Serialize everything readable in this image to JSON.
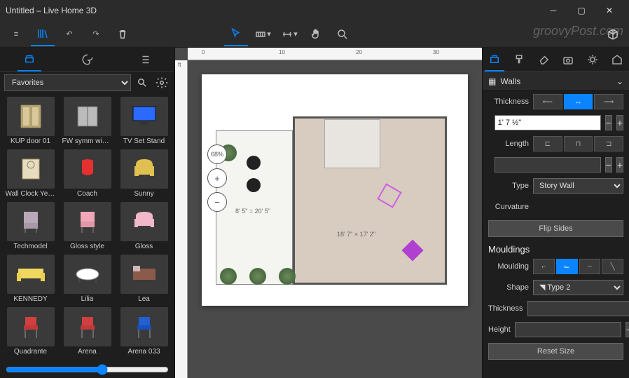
{
  "title": "Untitled – Live Home 3D",
  "watermark": "groovyPost.com",
  "favorites_label": "Favorites",
  "library": [
    {
      "label": "KUP door 01"
    },
    {
      "label": "FW symm windo…"
    },
    {
      "label": "TV Set Stand"
    },
    {
      "label": "Wall Clock Yello…"
    },
    {
      "label": "Coach"
    },
    {
      "label": "Sunny"
    },
    {
      "label": "Techmodel"
    },
    {
      "label": "Gloss style"
    },
    {
      "label": "Gloss"
    },
    {
      "label": "KENNEDY"
    },
    {
      "label": "Lilia"
    },
    {
      "label": "Lea"
    },
    {
      "label": "Quadrante"
    },
    {
      "label": "Arena"
    },
    {
      "label": "Arena 033"
    }
  ],
  "canvas": {
    "ruler_unit": "ft",
    "zoom_pct": "68%",
    "dim1": "8' 5\" = 20' 5\"",
    "dim2": "18' 7\" × 17' 2\"",
    "ruler_ticks": [
      "0",
      "10",
      "20",
      "30"
    ]
  },
  "inspector": {
    "section": "Walls",
    "thickness_label": "Thickness",
    "thickness_value": "1' 7 ½\"",
    "length_label": "Length",
    "length_value": "",
    "type_label": "Type",
    "type_value": "Story Wall",
    "curvature_label": "Curvature",
    "flip_label": "Flip Sides",
    "mouldings_hdr": "Mouldings",
    "moulding_label": "Moulding",
    "shape_label": "Shape",
    "shape_value": "Type 2",
    "m_thickness_label": "Thickness",
    "m_thickness_value": "",
    "height_label": "Height",
    "height_value": "",
    "reset_label": "Reset Size"
  }
}
